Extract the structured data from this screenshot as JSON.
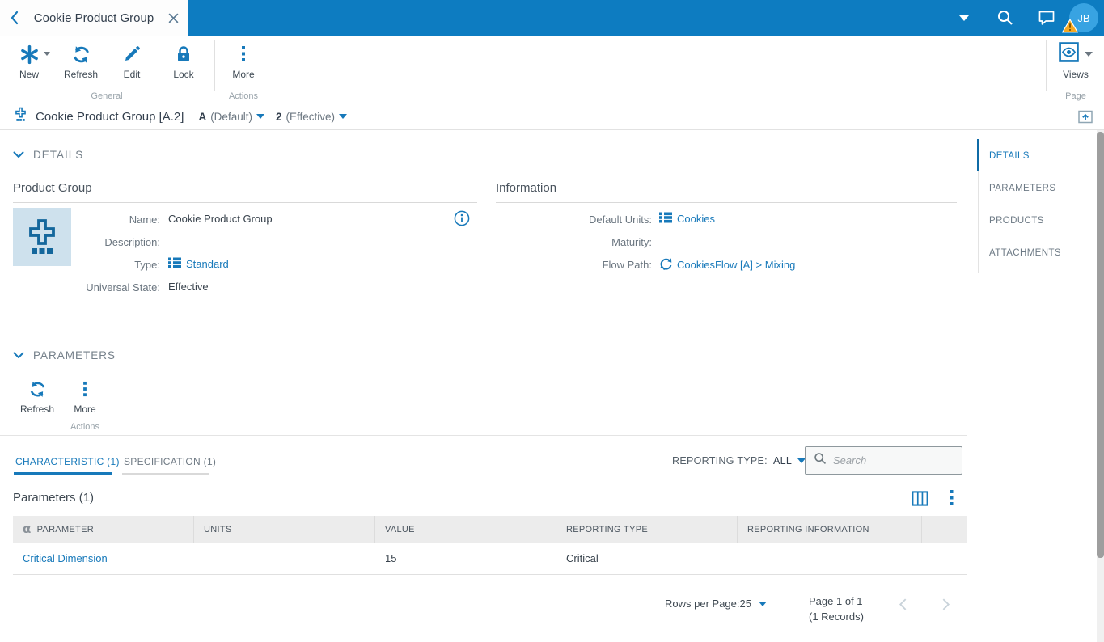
{
  "colors": {
    "topbar": "#0d7cc1",
    "accent": "#1779ba",
    "avatar": "#38a3e2",
    "warning": "#f6a821",
    "link": "#1779ba",
    "thumbnail_bg": "#cee1ed",
    "table_header_bg": "#ececec"
  },
  "topbar": {
    "tab_title": "Cookie Product Group",
    "user_initials": "JB"
  },
  "toolbar": {
    "new_label": "New",
    "refresh_label": "Refresh",
    "edit_label": "Edit",
    "lock_label": "Lock",
    "more_label": "More",
    "views_label": "Views",
    "general_group_label": "General",
    "actions_group_label": "Actions",
    "page_group_label": "Page"
  },
  "breadcrumb": {
    "title": "Cookie Product Group [A.2]",
    "revision": "A",
    "revision_note": "(Default)",
    "version": "2",
    "version_note": "(Effective)"
  },
  "details": {
    "heading": "DETAILS",
    "product_group": {
      "title": "Product Group",
      "name_label": "Name:",
      "name_value": "Cookie Product Group",
      "description_label": "Description:",
      "description_value": "",
      "type_label": "Type:",
      "type_value": "Standard",
      "universal_state_label": "Universal State:",
      "universal_state_value": "Effective"
    },
    "information": {
      "title": "Information",
      "default_units_label": "Default Units:",
      "default_units_value": "Cookies",
      "maturity_label": "Maturity:",
      "maturity_value": "",
      "flow_path_label": "Flow Path:",
      "flow_path_value": "CookiesFlow [A] > Mixing"
    }
  },
  "parameters": {
    "heading": "PARAMETERS",
    "toolbar": {
      "refresh_label": "Refresh",
      "more_label": "More",
      "actions_group_label": "Actions"
    },
    "tabs": {
      "characteristic": "CHARACTERISTIC (1)",
      "specification": "SPECIFICATION (1)"
    },
    "reporting_type_label": "REPORTING TYPE:",
    "reporting_type_value": "ALL",
    "search_placeholder": "Search",
    "table_title": "Parameters (1)",
    "table": {
      "columns": [
        "PARAMETER",
        "UNITS",
        "VALUE",
        "REPORTING TYPE",
        "REPORTING INFORMATION"
      ],
      "rows": [
        {
          "parameter": "Critical Dimension",
          "units": "",
          "value": "15",
          "reporting_type": "Critical",
          "reporting_information": ""
        }
      ]
    },
    "pagination": {
      "rows_per_page_label": "Rows per Page:",
      "rows_per_page_value": "25",
      "page_label": "Page 1 of 1",
      "records_label": "(1 Records)"
    }
  },
  "sidebar": {
    "items": [
      {
        "label": "DETAILS",
        "active": true
      },
      {
        "label": "PARAMETERS",
        "active": false
      },
      {
        "label": "PRODUCTS",
        "active": false
      },
      {
        "label": "ATTACHMENTS",
        "active": false
      }
    ]
  }
}
